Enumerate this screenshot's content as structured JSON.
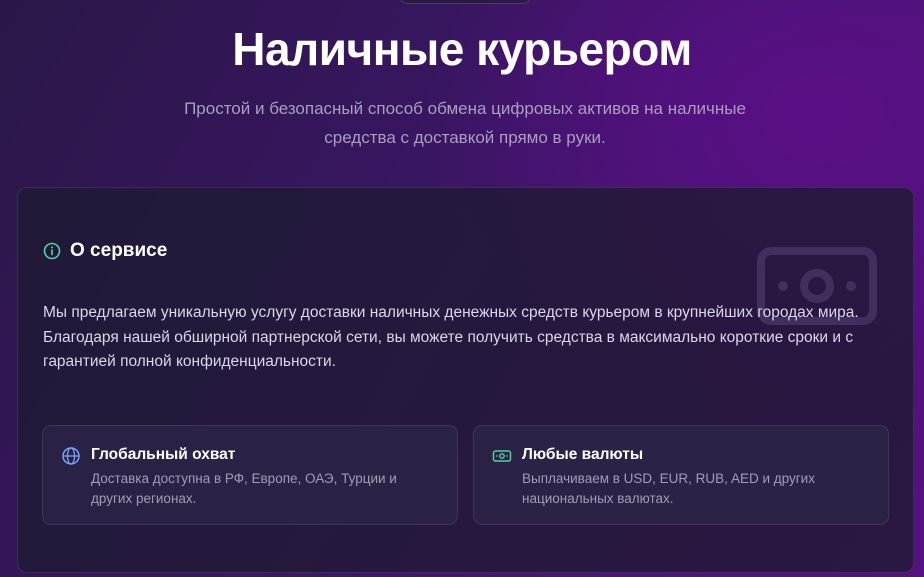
{
  "header": {
    "title": "Наличные курьером",
    "subtitle": "Простой и безопасный способ обмена цифровых активов на наличные средства с доставкой прямо в руки."
  },
  "about": {
    "title": "О сервисе",
    "title_icon": "info-icon",
    "background_icon": "banknote-icon",
    "description": "Мы предлагаем уникальную услугу доставки наличных денежных средств курьером в крупнейших городах мира. Благодаря нашей обширной партнерской сети, вы можете получить средства в максимально короткие сроки и с гарантией полной конфиденциальности."
  },
  "features": [
    {
      "icon": "globe-icon",
      "title": "Глобальный охват",
      "text": "Доставка доступна в РФ, Европе, ОАЭ, Турции и других регионах."
    },
    {
      "icon": "banknote-icon",
      "title": "Любые валюты",
      "text": "Выплачиваем в USD, EUR, RUB, AED и других национальных валютах."
    }
  ],
  "colors": {
    "accent_green": "#4fd1a0",
    "accent_blue": "#7aa2ff",
    "background_start": "#2a1748",
    "background_end": "#54127e"
  }
}
